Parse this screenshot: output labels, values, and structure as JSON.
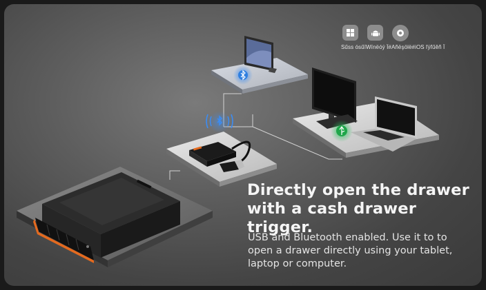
{
  "os_support": {
    "icons": [
      "windows-icon",
      "android-icon",
      "ios-icon"
    ],
    "caption": "Sűss ósűïWïnëóý Ï#Añëşölë#iOS ľýľűěñ Ï"
  },
  "headline": {
    "line1": "Directly open the drawer",
    "line2": "with a cash drawer trigger."
  },
  "body": {
    "line1": "USB and Bluetooth enabled. Use it to to",
    "line2": "open a drawer directly using your tablet,",
    "line3": "laptop or computer."
  },
  "colors": {
    "bluetooth_badge": "#2f7fe0",
    "usb_badge": "#1fa64a",
    "drawer_accent": "#e46a1f"
  }
}
